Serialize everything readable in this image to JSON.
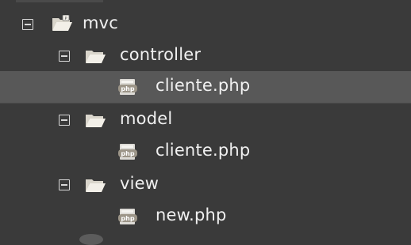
{
  "colors": {
    "background": "#3a3a3a",
    "selected_row": "#585858",
    "text": "#f0f0f0",
    "folder": "#e7e4dc"
  },
  "tree": {
    "root": {
      "label": "mvc",
      "icon": "project-folder-icon",
      "expanded": true
    },
    "controller": {
      "label": "controller",
      "icon": "folder-open-icon",
      "expanded": true
    },
    "controller_file": {
      "label": "cliente.php",
      "icon": "php-file-icon",
      "selected": true
    },
    "model": {
      "label": "model",
      "icon": "folder-open-icon",
      "expanded": true
    },
    "model_file": {
      "label": "cliente.php",
      "icon": "php-file-icon"
    },
    "view": {
      "label": "view",
      "icon": "folder-open-icon",
      "expanded": true
    },
    "view_file": {
      "label": "new.php",
      "icon": "php-file-icon"
    }
  }
}
